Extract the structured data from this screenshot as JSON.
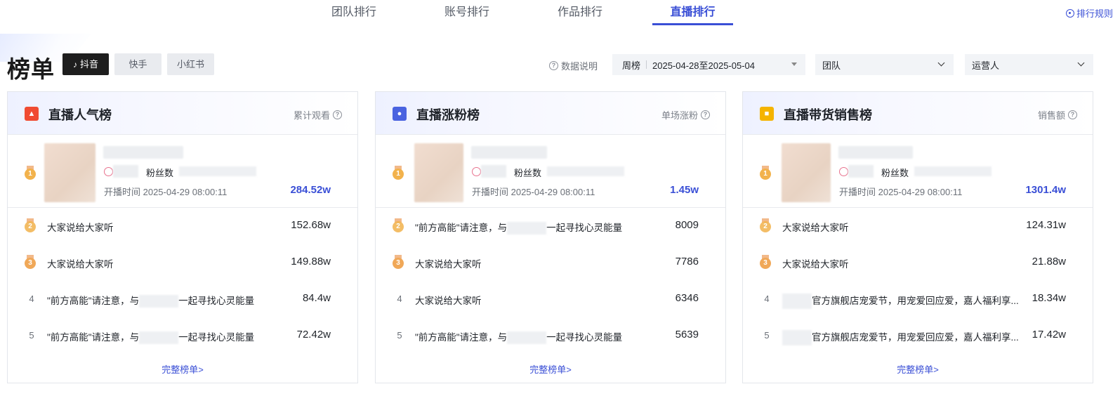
{
  "tabs": [
    {
      "label": "团队排行"
    },
    {
      "label": "账号排行"
    },
    {
      "label": "作品排行"
    },
    {
      "label": "直播排行"
    }
  ],
  "rules_link": "排行规则",
  "page_title": "榜单",
  "platforms": [
    {
      "label": "抖音"
    },
    {
      "label": "快手"
    },
    {
      "label": "小红书"
    }
  ],
  "filters": {
    "data_explain": "数据说明",
    "period_type": "周榜",
    "period_range": "2025-04-28至2025-05-04",
    "scope": "团队",
    "operator": "运营人"
  },
  "cards": [
    {
      "title": "直播人气榜",
      "metric": "累计观看",
      "top1": {
        "fans_label": "粉丝数",
        "start_time": "开播时间 2025-04-29 08:00:11",
        "value": "284.52w"
      },
      "rows": [
        {
          "rank": "2",
          "text": "大家说给大家听",
          "value": "152.68w"
        },
        {
          "rank": "3",
          "text": "大家说给大家听",
          "value": "149.88w"
        },
        {
          "rank": "4",
          "text_a": "\"前方高能\"请注意，与",
          "text_b": "一起寻找心灵能量",
          "value": "84.4w"
        },
        {
          "rank": "5",
          "text_a": "\"前方高能\"请注意，与",
          "text_b": "一起寻找心灵能量",
          "value": "72.42w"
        }
      ],
      "full_link": "完整榜单>"
    },
    {
      "title": "直播涨粉榜",
      "metric": "单场涨粉",
      "top1": {
        "fans_label": "粉丝数",
        "start_time": "开播时间 2025-04-29 08:00:11",
        "value": "1.45w"
      },
      "rows": [
        {
          "rank": "2",
          "text_a": "\"前方高能\"请注意，与",
          "text_b": "一起寻找心灵能量",
          "value": "8009"
        },
        {
          "rank": "3",
          "text": "大家说给大家听",
          "value": "7786"
        },
        {
          "rank": "4",
          "text": "大家说给大家听",
          "value": "6346"
        },
        {
          "rank": "5",
          "text_a": "\"前方高能\"请注意，与",
          "text_b": "一起寻找心灵能量",
          "value": "5639"
        }
      ],
      "full_link": "完整榜单>"
    },
    {
      "title": "直播带货销售榜",
      "metric": "销售额",
      "top1": {
        "fans_label": "粉丝数",
        "start_time": "开播时间 2025-04-29 08:00:11",
        "value": "1301.4w"
      },
      "rows": [
        {
          "rank": "2",
          "text": "大家说给大家听",
          "value": "124.31w"
        },
        {
          "rank": "3",
          "text": "大家说给大家听",
          "value": "21.88w"
        },
        {
          "rank": "4",
          "text_b": "官方旗舰店宠爱节，用宠爱回应爱，嘉人福利享...",
          "value": "18.34w"
        },
        {
          "rank": "5",
          "text_b": "官方旗舰店宠爱节，用宠爱回应爱，嘉人福利享...",
          "value": "17.42w"
        }
      ],
      "full_link": "完整榜单>"
    }
  ],
  "colors": {
    "accent": "#3a4fd6",
    "icon_fire": "#f04b32",
    "icon_fans": "#4a63e0",
    "icon_bag": "#f5b400"
  }
}
